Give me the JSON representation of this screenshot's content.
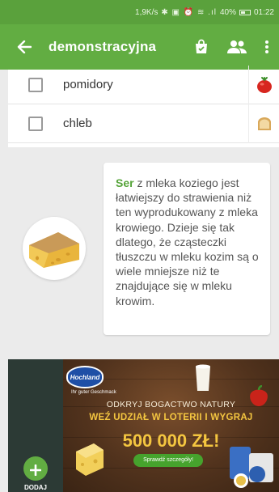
{
  "status_bar": {
    "net_speed": "1,9K/s",
    "icons": "✱ ▣ ⏰ ≋ .ıl",
    "battery": "40%",
    "time": "01:22"
  },
  "app_bar": {
    "title": "demonstracyjna",
    "back_icon": "arrow-left-icon",
    "actions": [
      "shopping-bag-icon",
      "people-icon",
      "more-vert-icon"
    ]
  },
  "list": {
    "items": [
      {
        "label": "pomidory",
        "icon": "tomato-icon",
        "checked": false
      },
      {
        "label": "chleb",
        "icon": "bread-icon",
        "checked": false
      }
    ]
  },
  "tip": {
    "highlight": "Ser",
    "text": " z mleka koziego jest łatwiejszy do strawienia niż ten wyprodukowany z mleka krowiego. Dzieje się tak dlatego, że cząsteczki tłuszczu w mleku kozim są o wiele mniejsze niż te znajdujące się w mleku krowim.",
    "image": "cheese-icon"
  },
  "bottom": {
    "add_label": "DODAJ"
  },
  "ad": {
    "brand": "Hochland",
    "brand_sub": "Ihr guter Geschmack",
    "line1": "ODKRYJ BOGACTWO NATURY",
    "line2": "WEŹ UDZIAŁ W LOTERII I WYGRAJ",
    "prize": "500 000 ZŁ!",
    "cta": "Sprawdź szczegóły!"
  },
  "colors": {
    "appbar": "#62ad42",
    "statusbar": "#5aa13c",
    "accent_text": "#56a43a",
    "add_button": "#62ad42"
  }
}
